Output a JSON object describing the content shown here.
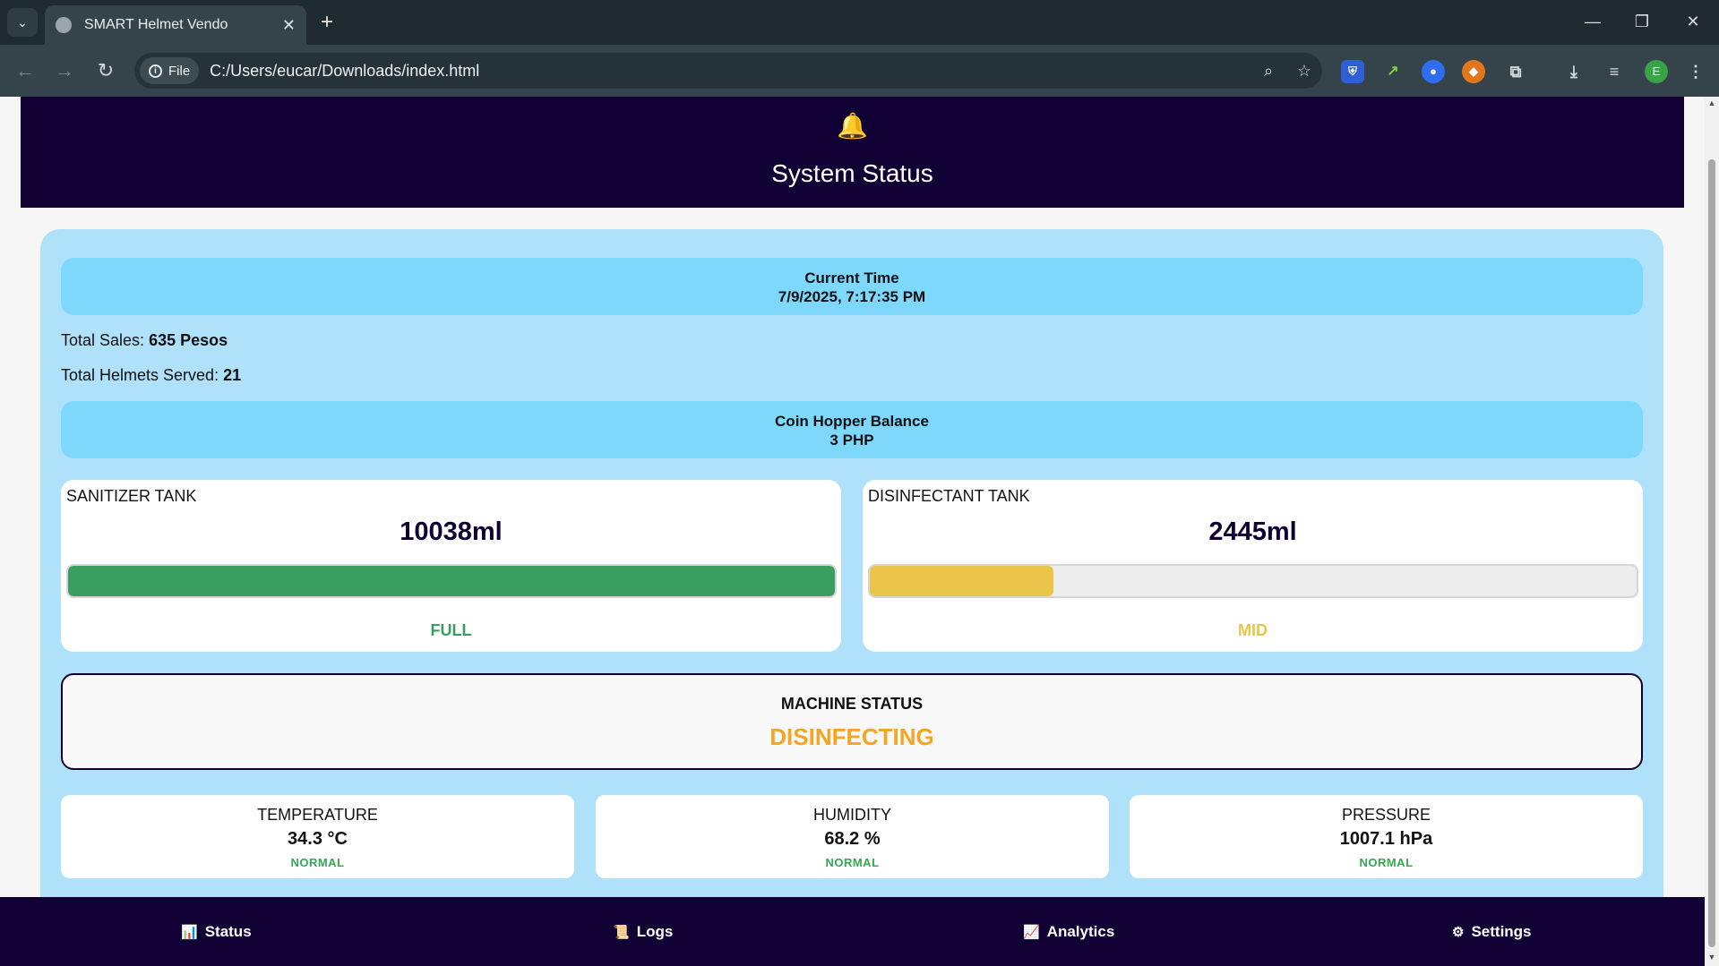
{
  "browser": {
    "tab_title": "SMART Helmet Vendo",
    "url_chip": "File",
    "url": "C:/Users/eucar/Downloads/index.html",
    "profile_initial": "E"
  },
  "header": {
    "bell_icon": "🔔",
    "title": "System Status"
  },
  "current_time": {
    "label": "Current Time",
    "value": "7/9/2025, 7:17:35 PM"
  },
  "totals": {
    "sales_label": "Total Sales:",
    "sales_value": "635 Pesos",
    "helmets_label": "Total Helmets Served:",
    "helmets_value": "21"
  },
  "coin_hopper": {
    "label": "Coin Hopper Balance",
    "value": "3 PHP"
  },
  "tanks": [
    {
      "label": "SANITIZER TANK",
      "value": "10038ml",
      "level": "FULL",
      "fill_fraction": 1.0,
      "color": "#3a9e63"
    },
    {
      "label": "DISINFECTANT TANK",
      "value": "2445ml",
      "level": "MID",
      "fill_fraction": 0.24,
      "color": "#ebc54a"
    }
  ],
  "machine": {
    "label": "MACHINE STATUS",
    "value": "DISINFECTING"
  },
  "sensors": [
    {
      "label": "TEMPERATURE",
      "value": "34.3 °C",
      "status": "NORMAL"
    },
    {
      "label": "HUMIDITY",
      "value": "68.2 %",
      "status": "NORMAL"
    },
    {
      "label": "PRESSURE",
      "value": "1007.1 hPa",
      "status": "NORMAL"
    }
  ],
  "bottom_nav": [
    {
      "icon": "📊",
      "label": "Status"
    },
    {
      "icon": "📜",
      "label": "Logs"
    },
    {
      "icon": "📈",
      "label": "Analytics"
    },
    {
      "icon": "⚙",
      "label": "Settings"
    }
  ]
}
